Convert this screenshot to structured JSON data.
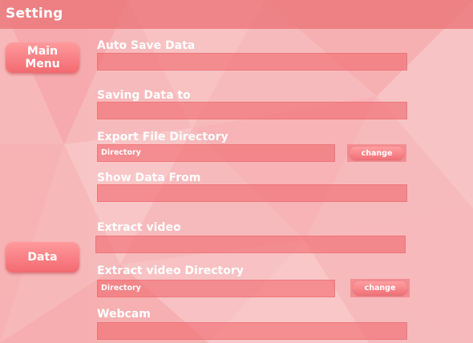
{
  "window": {
    "title": "Setting"
  },
  "sidebar": {
    "main_menu_label": "Main\nMenu",
    "data_label": "Data"
  },
  "settings": {
    "auto_save": {
      "label": "Auto Save Data",
      "value": ""
    },
    "saving_to": {
      "label": "Saving Data to",
      "value": ""
    },
    "export_dir": {
      "label": "Export File Directory",
      "value": "Directory",
      "button": "change"
    },
    "show_from": {
      "label": "Show Data From",
      "value": ""
    },
    "extract_video": {
      "label": "Extract video",
      "value": ""
    },
    "extract_dir": {
      "label": "Extract video Directory",
      "value": "Directory",
      "button": "change"
    },
    "webcam": {
      "label": "Webcam",
      "value": ""
    }
  },
  "colors": {
    "background": "#f7b3b5",
    "titlebar": "#ec767a",
    "accent": "#f36a70",
    "text": "#ffffff"
  }
}
